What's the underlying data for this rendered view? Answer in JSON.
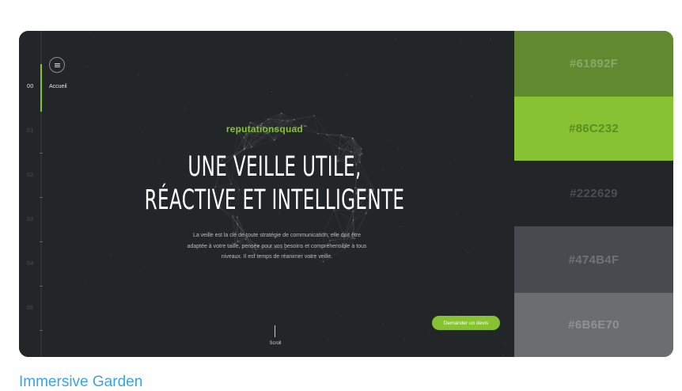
{
  "hero": {
    "nav": [
      {
        "num": "00",
        "label": "Accueil",
        "active": true
      },
      {
        "num": "01"
      },
      {
        "num": "02"
      },
      {
        "num": "03"
      },
      {
        "num": "04"
      },
      {
        "num": "05"
      }
    ],
    "brand": "reputationsquad",
    "brand_tm": "™",
    "headline_1": "UNE VEILLE UTILE,",
    "headline_2": "RÉACTIVE ET INTELLIGENTE",
    "desc_1": "La veille est la clé de toute stratégie de communication, elle doit être",
    "desc_2": "adaptée à votre taille, pensée pour vos besoins et compréhensible à tous",
    "desc_3": "niveaux. Il est temps de réanimer votre veille.",
    "scroll_label": "Scroll",
    "cta_label": "Demander un devis"
  },
  "palette": [
    {
      "hex": "#61892F",
      "label": "#61892F",
      "text_color": "#88a86a"
    },
    {
      "hex": "#86C232",
      "label": "#86C232",
      "text_color": "#5f8c22"
    },
    {
      "hex": "#222629",
      "label": "#222629",
      "text_color": "#4a4f53"
    },
    {
      "hex": "#474B4F",
      "label": "#474B4F",
      "text_color": "#6f7377"
    },
    {
      "hex": "#6B6E70",
      "label": "#6B6E70",
      "text_color": "#8f9294"
    }
  ],
  "caption": "Immersive Garden"
}
